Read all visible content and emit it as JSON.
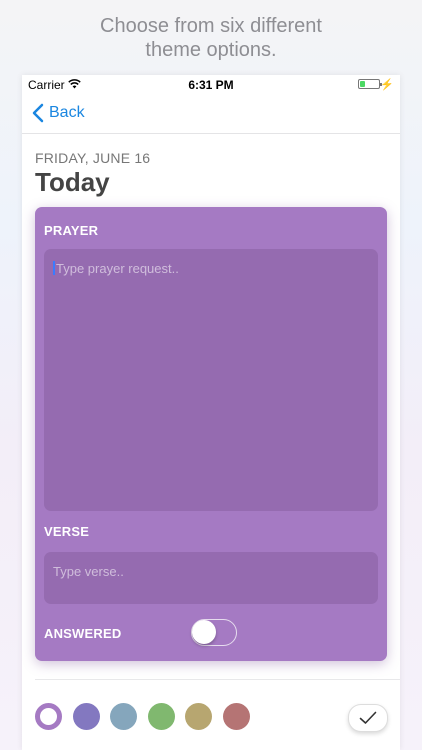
{
  "caption": {
    "line1": "Choose from six different",
    "line2": "theme options."
  },
  "status_bar": {
    "carrier": "Carrier",
    "time": "6:31 PM",
    "battery_level": 0.3
  },
  "nav": {
    "back_label": "Back"
  },
  "entry": {
    "date": "FRIDAY, JUNE 16",
    "title": "Today"
  },
  "form": {
    "prayer_label": "PRAYER",
    "prayer_placeholder": "Type prayer request..",
    "verse_label": "VERSE",
    "verse_placeholder": "Type verse..",
    "answered_label": "ANSWERED",
    "answered_on": false
  },
  "themes": {
    "selected_index": 0,
    "colors": [
      "#a57ac3",
      "#8378c0",
      "#85a6bc",
      "#80b86f",
      "#b7a670",
      "#b57474"
    ]
  },
  "colors": {
    "accent": "#1a86e0",
    "card": "#a57ac3"
  }
}
